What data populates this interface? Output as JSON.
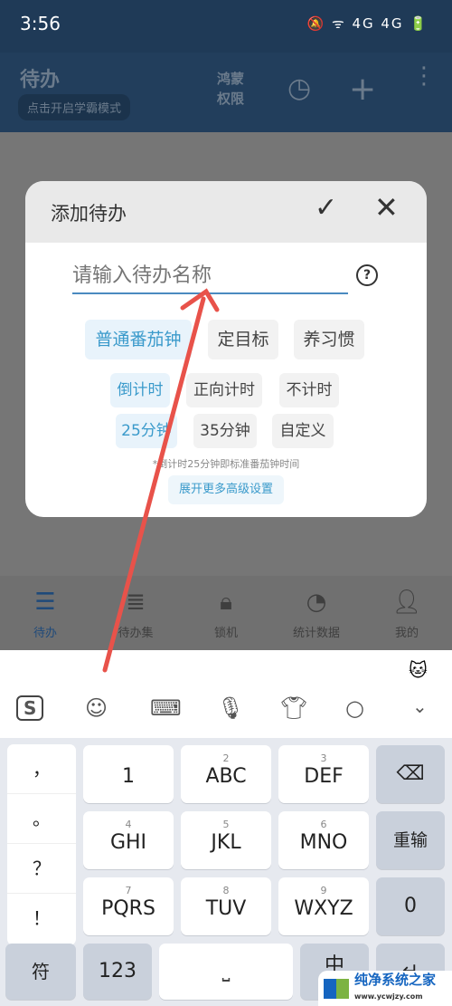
{
  "status": {
    "time": "3:56",
    "icons": "🔕 ᯤ 4G 4G 🔋"
  },
  "appbar": {
    "title": "待办",
    "mode_button": "点击开启学霸模式",
    "permission": "鸿蒙 权限"
  },
  "bottom_nav": [
    {
      "label": "待办",
      "icon": "list-icon"
    },
    {
      "label": "待办集",
      "icon": "collection-icon"
    },
    {
      "label": "锁机",
      "icon": "lock-icon"
    },
    {
      "label": "统计数据",
      "icon": "pie-chart-icon"
    },
    {
      "label": "我的",
      "icon": "person-icon"
    }
  ],
  "dialog": {
    "title": "添加待办",
    "name_placeholder": "请输入待办名称",
    "types": [
      "普通番茄钟",
      "定目标",
      "养习惯"
    ],
    "timer_modes": [
      "倒计时",
      "正向计时",
      "不计时"
    ],
    "durations": [
      "25分钟",
      "35分钟",
      "自定义"
    ],
    "hint": "*倒计时25分钟即标准番茄钟时间",
    "more": "展开更多高级设置"
  },
  "keyboard": {
    "side": [
      "，",
      "。",
      "？",
      "！"
    ],
    "keys": [
      {
        "sub": "",
        "main": "1"
      },
      {
        "sub": "2",
        "main": "ABC"
      },
      {
        "sub": "3",
        "main": "DEF"
      },
      {
        "sub": "4",
        "main": "GHI"
      },
      {
        "sub": "5",
        "main": "JKL"
      },
      {
        "sub": "6",
        "main": "MNO"
      },
      {
        "sub": "7",
        "main": "PQRS"
      },
      {
        "sub": "8",
        "main": "TUV"
      },
      {
        "sub": "9",
        "main": "WXYZ"
      }
    ],
    "reset": "重输",
    "zero": "0",
    "symbol": "符",
    "num": "123",
    "lang": "中"
  },
  "watermark": {
    "text": "纯净系统之家",
    "url": "www.ycwjzy.com"
  },
  "colors": {
    "accent": "#3a9acb",
    "arrow": "#e8524a"
  }
}
